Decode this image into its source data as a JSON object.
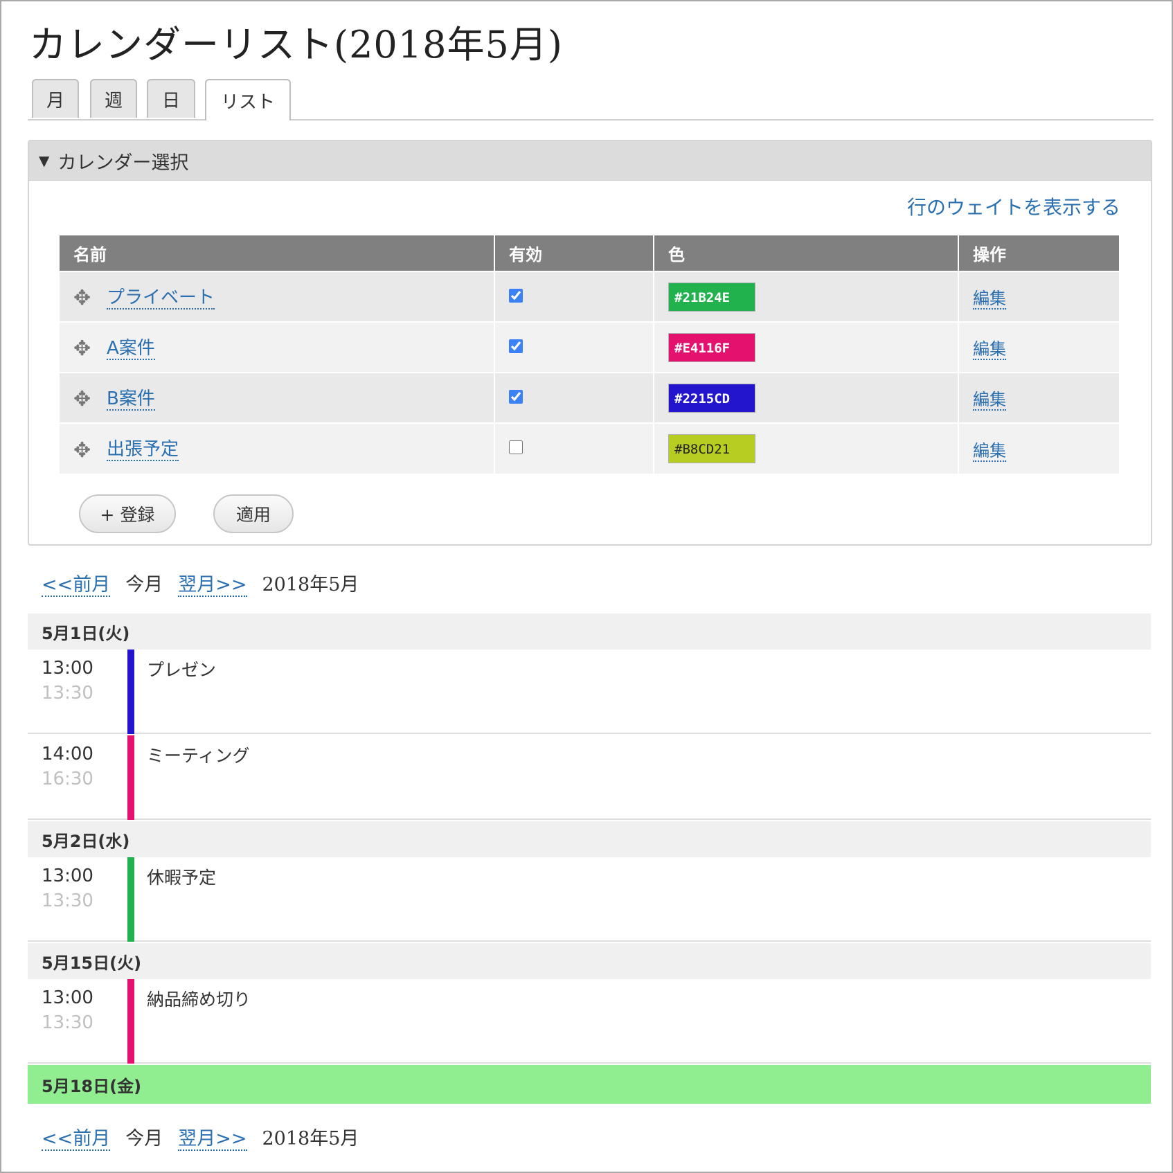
{
  "page": {
    "title": "カレンダーリスト(2018年5月)"
  },
  "tabs": [
    {
      "label": "月",
      "active": false
    },
    {
      "label": "週",
      "active": false
    },
    {
      "label": "日",
      "active": false
    },
    {
      "label": "リスト",
      "active": true
    }
  ],
  "calendar_select": {
    "toggle_icon": "▼",
    "header": "カレンダー選択",
    "weights_link": "行のウェイトを表示する",
    "columns": [
      "名前",
      "有効",
      "色",
      "操作"
    ],
    "rows": [
      {
        "name": "プライベート",
        "enabled": true,
        "color": "#21B24E",
        "action": "編集"
      },
      {
        "name": "A案件",
        "enabled": true,
        "color": "#E4116F",
        "action": "編集"
      },
      {
        "name": "B案件",
        "enabled": true,
        "color": "#2215CD",
        "action": "編集"
      },
      {
        "name": "出張予定",
        "enabled": false,
        "color": "#B8CD21",
        "action": "編集"
      }
    ],
    "buttons": {
      "add": "+ 登録",
      "apply": "適用"
    }
  },
  "month_nav": {
    "prev": "<<前月",
    "current": "今月",
    "next": "翌月>>",
    "label": "2018年5月"
  },
  "days": [
    {
      "date": "5月1日(火)",
      "today": false,
      "events": [
        {
          "start": "13:00",
          "end": "13:30",
          "title": "プレゼン",
          "color": "#2215CD"
        },
        {
          "start": "14:00",
          "end": "16:30",
          "title": "ミーティング",
          "color": "#E4116F"
        }
      ]
    },
    {
      "date": "5月2日(水)",
      "today": false,
      "events": [
        {
          "start": "13:00",
          "end": "13:30",
          "title": "休暇予定",
          "color": "#21B24E"
        }
      ]
    },
    {
      "date": "5月15日(火)",
      "today": false,
      "events": [
        {
          "start": "13:00",
          "end": "13:30",
          "title": "納品締め切り",
          "color": "#E4116F"
        }
      ]
    },
    {
      "date": "5月18日(金)",
      "today": true,
      "events": []
    }
  ],
  "icons": {
    "drag": "drag-handle-icon"
  },
  "colors": {
    "link": "#2a6fb0",
    "today_highlight": "#90ee90",
    "table_header": "#808080"
  }
}
